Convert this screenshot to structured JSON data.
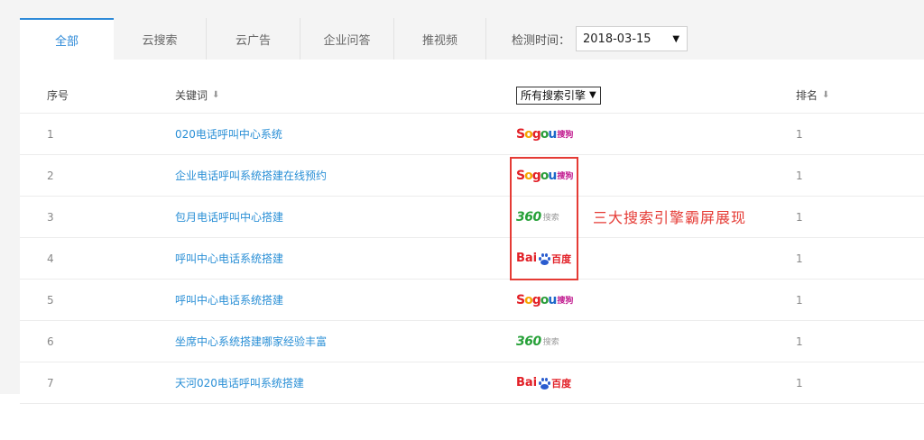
{
  "tabs": [
    {
      "label": "全部",
      "active": true
    },
    {
      "label": "云搜索"
    },
    {
      "label": "云广告"
    },
    {
      "label": "企业问答"
    },
    {
      "label": "推视频"
    }
  ],
  "date_filter": {
    "label": "检测时间：",
    "value": "2018-03-15"
  },
  "table": {
    "headers": {
      "index": "序号",
      "keyword": "关键词",
      "engine_select": "所有搜索引擎",
      "rank": "排名"
    },
    "rows": [
      {
        "index": "1",
        "keyword": "020电话呼叫中心系统",
        "engine": "sogou",
        "rank": "1"
      },
      {
        "index": "2",
        "keyword": "企业电话呼叫系统搭建在线预约",
        "engine": "sogou",
        "rank": "1"
      },
      {
        "index": "3",
        "keyword": "包月电话呼叫中心搭建",
        "engine": "360",
        "rank": "1"
      },
      {
        "index": "4",
        "keyword": "呼叫中心电话系统搭建",
        "engine": "baidu",
        "rank": "1"
      },
      {
        "index": "5",
        "keyword": "呼叫中心电话系统搭建",
        "engine": "sogou",
        "rank": "1"
      },
      {
        "index": "6",
        "keyword": "坐席中心系统搭建哪家经验丰富",
        "engine": "360",
        "rank": "1"
      },
      {
        "index": "7",
        "keyword": "天河020电话呼叫系统搭建",
        "engine": "baidu",
        "rank": "1"
      }
    ]
  },
  "engine_logos": {
    "sogou": {
      "s": "S",
      "o1": "o",
      "g": "g",
      "o2": "o",
      "u": "u",
      "cn": "搜狗"
    },
    "360": {
      "num": "360",
      "cn": "搜索"
    },
    "baidu": {
      "bai": "Bai",
      "cn": "百度"
    }
  },
  "annotation": "三大搜索引擎霸屏展现",
  "colors": {
    "accent": "#2e8ad8",
    "link": "#2a8fd6",
    "highlight": "#e53b35"
  },
  "icons": {
    "sort": "sort-down-icon",
    "caret": "caret-down-icon"
  }
}
